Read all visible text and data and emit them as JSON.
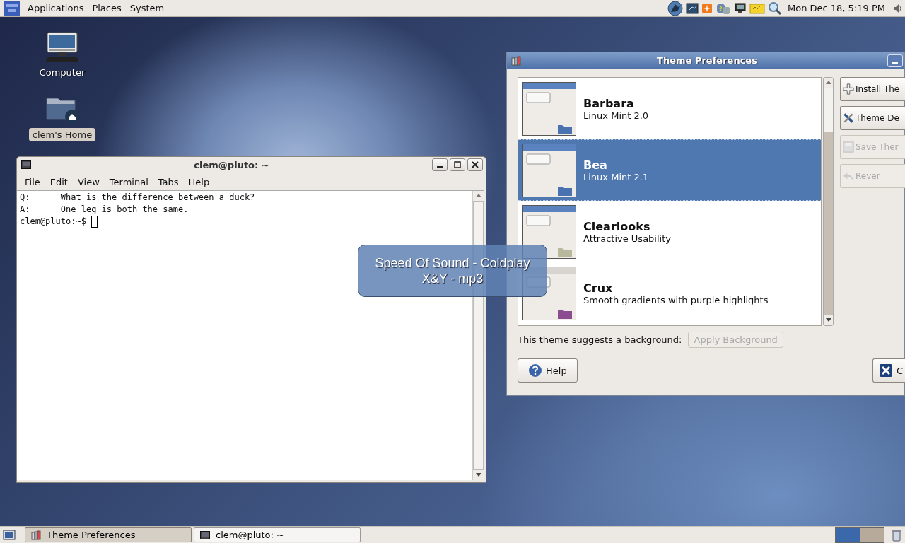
{
  "top_panel": {
    "menus": [
      "Applications",
      "Places",
      "System"
    ],
    "clock": "Mon Dec 18,  5:19 PM"
  },
  "desktop_icons": [
    {
      "label": "Computer",
      "kind": "computer",
      "selected": false
    },
    {
      "label": "clem's Home",
      "kind": "home",
      "selected": true
    }
  ],
  "terminal": {
    "title": "clem@pluto: ~",
    "menu": [
      "File",
      "Edit",
      "View",
      "Terminal",
      "Tabs",
      "Help"
    ],
    "lines": [
      "Q:      What is the difference between a duck?",
      "A:      One leg is both the same.",
      "clem@pluto:~$ "
    ]
  },
  "theme_window": {
    "title": "Theme Preferences",
    "themes": [
      {
        "name": "Barbara",
        "description": "Linux Mint 2.0",
        "selected": false,
        "color": "#4a72b0"
      },
      {
        "name": "Bea",
        "description": "Linux Mint 2.1",
        "selected": true,
        "color": "#4a72b0"
      },
      {
        "name": "Clearlooks",
        "description": "Attractive Usability",
        "selected": false,
        "color": "#b8b89c"
      },
      {
        "name": "Crux",
        "description": "Smooth gradients with purple highlights",
        "selected": false,
        "color": "#8c4c90"
      }
    ],
    "side_buttons": [
      {
        "label": "Install The",
        "kind": "install",
        "disabled": false
      },
      {
        "label": "Theme De",
        "kind": "tools",
        "disabled": false
      },
      {
        "label": "Save Ther",
        "kind": "save",
        "disabled": true
      },
      {
        "label": "Rever",
        "kind": "revert",
        "disabled": true
      }
    ],
    "background_label": "This theme suggests a background:",
    "apply_background": {
      "label": "Apply Background",
      "disabled": true
    },
    "help_button": "Help",
    "close_button": "C"
  },
  "notification": {
    "lines": [
      "Speed Of Sound - Coldplay",
      "X&Y - mp3"
    ]
  },
  "taskbar": [
    {
      "label": "Theme Preferences",
      "selected": true
    },
    {
      "label": "clem@pluto: ~",
      "selected": false
    }
  ],
  "workspaces": [
    {
      "selected": true
    },
    {
      "selected": false
    }
  ]
}
